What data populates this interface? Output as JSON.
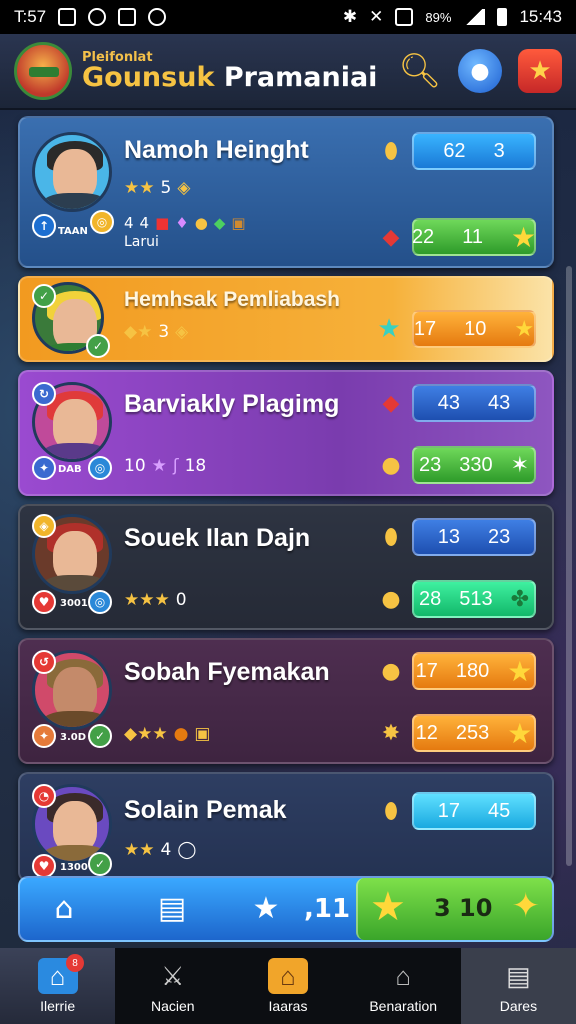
{
  "status_bar": {
    "time_left": "T:57",
    "battery_pct": "89%",
    "time_right": "15:43"
  },
  "header": {
    "subtitle": "Pleifonlat",
    "title_part1": "Gounsuk",
    "title_part2": "Pramaniai"
  },
  "players": [
    {
      "name": "Namoh Heinght",
      "stats_line1": "5",
      "stats_line2_a": "4",
      "stats_line2_b": "4",
      "stats_line2_label": "Larui",
      "avatar_label": "TAAN",
      "pill1": {
        "a": "62",
        "b": "3"
      },
      "pill2": {
        "a": "22",
        "b": "11"
      }
    },
    {
      "name": "Hemhsak Pemliabash",
      "stats_line1": "3",
      "pill1": {
        "a": "17",
        "b": "10"
      }
    },
    {
      "name": "Barviakly Plagimg",
      "stats_line1_a": "10",
      "stats_line1_b": "18",
      "avatar_label": "DAB",
      "pill1": {
        "a": "43",
        "b": "43"
      },
      "pill2": {
        "a": "23",
        "b": "330"
      }
    },
    {
      "name": "Souek Ilan Dajn",
      "stats_line1": "0",
      "avatar_label": "3001",
      "pill1": {
        "a": "13",
        "b": "23"
      },
      "pill2": {
        "a": "28",
        "b": "513"
      }
    },
    {
      "name": "Sobah Fyemakan",
      "avatar_label": "3.0D",
      "pill1": {
        "a": "17",
        "b": "180"
      },
      "pill2": {
        "a": "12",
        "b": "253"
      }
    },
    {
      "name": "Solain Pemak",
      "stats_line1": "4",
      "avatar_label": "1300",
      "pill1": {
        "a": "17",
        "b": "45"
      }
    }
  ],
  "action_bar": {
    "count": ",11",
    "green_value": "3 10"
  },
  "tabs": [
    {
      "label": "Ilerrie",
      "icon": "home-icon",
      "badge": "8"
    },
    {
      "label": "Nacien",
      "icon": "sword-icon"
    },
    {
      "label": "Iaaras",
      "icon": "shop-icon"
    },
    {
      "label": "Benaration",
      "icon": "house-icon"
    },
    {
      "label": "Dares",
      "icon": "server-icon"
    }
  ],
  "colors": {
    "accent_gold": "#f6c343",
    "card_blue": "#2d5f9e",
    "card_orange": "#f39a1e",
    "card_purple": "#8e46c2",
    "card_dark": "#2a2f3c",
    "card_plum": "#4a2c4a",
    "card_navy": "#2a3a5c"
  }
}
